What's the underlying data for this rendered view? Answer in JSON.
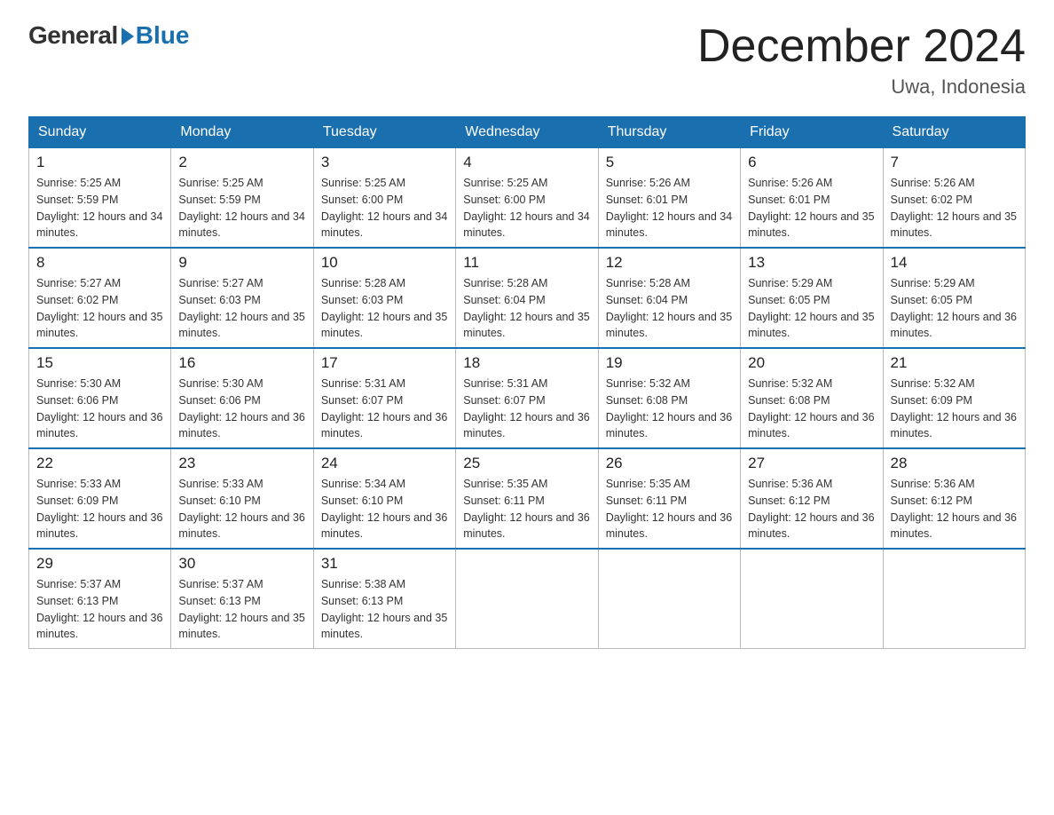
{
  "header": {
    "logo_general": "General",
    "logo_blue": "Blue",
    "title": "December 2024",
    "location": "Uwa, Indonesia"
  },
  "days_of_week": [
    "Sunday",
    "Monday",
    "Tuesday",
    "Wednesday",
    "Thursday",
    "Friday",
    "Saturday"
  ],
  "weeks": [
    [
      {
        "day": "1",
        "sunrise": "5:25 AM",
        "sunset": "5:59 PM",
        "daylight": "12 hours and 34 minutes."
      },
      {
        "day": "2",
        "sunrise": "5:25 AM",
        "sunset": "5:59 PM",
        "daylight": "12 hours and 34 minutes."
      },
      {
        "day": "3",
        "sunrise": "5:25 AM",
        "sunset": "6:00 PM",
        "daylight": "12 hours and 34 minutes."
      },
      {
        "day": "4",
        "sunrise": "5:25 AM",
        "sunset": "6:00 PM",
        "daylight": "12 hours and 34 minutes."
      },
      {
        "day": "5",
        "sunrise": "5:26 AM",
        "sunset": "6:01 PM",
        "daylight": "12 hours and 34 minutes."
      },
      {
        "day": "6",
        "sunrise": "5:26 AM",
        "sunset": "6:01 PM",
        "daylight": "12 hours and 35 minutes."
      },
      {
        "day": "7",
        "sunrise": "5:26 AM",
        "sunset": "6:02 PM",
        "daylight": "12 hours and 35 minutes."
      }
    ],
    [
      {
        "day": "8",
        "sunrise": "5:27 AM",
        "sunset": "6:02 PM",
        "daylight": "12 hours and 35 minutes."
      },
      {
        "day": "9",
        "sunrise": "5:27 AM",
        "sunset": "6:03 PM",
        "daylight": "12 hours and 35 minutes."
      },
      {
        "day": "10",
        "sunrise": "5:28 AM",
        "sunset": "6:03 PM",
        "daylight": "12 hours and 35 minutes."
      },
      {
        "day": "11",
        "sunrise": "5:28 AM",
        "sunset": "6:04 PM",
        "daylight": "12 hours and 35 minutes."
      },
      {
        "day": "12",
        "sunrise": "5:28 AM",
        "sunset": "6:04 PM",
        "daylight": "12 hours and 35 minutes."
      },
      {
        "day": "13",
        "sunrise": "5:29 AM",
        "sunset": "6:05 PM",
        "daylight": "12 hours and 35 minutes."
      },
      {
        "day": "14",
        "sunrise": "5:29 AM",
        "sunset": "6:05 PM",
        "daylight": "12 hours and 36 minutes."
      }
    ],
    [
      {
        "day": "15",
        "sunrise": "5:30 AM",
        "sunset": "6:06 PM",
        "daylight": "12 hours and 36 minutes."
      },
      {
        "day": "16",
        "sunrise": "5:30 AM",
        "sunset": "6:06 PM",
        "daylight": "12 hours and 36 minutes."
      },
      {
        "day": "17",
        "sunrise": "5:31 AM",
        "sunset": "6:07 PM",
        "daylight": "12 hours and 36 minutes."
      },
      {
        "day": "18",
        "sunrise": "5:31 AM",
        "sunset": "6:07 PM",
        "daylight": "12 hours and 36 minutes."
      },
      {
        "day": "19",
        "sunrise": "5:32 AM",
        "sunset": "6:08 PM",
        "daylight": "12 hours and 36 minutes."
      },
      {
        "day": "20",
        "sunrise": "5:32 AM",
        "sunset": "6:08 PM",
        "daylight": "12 hours and 36 minutes."
      },
      {
        "day": "21",
        "sunrise": "5:32 AM",
        "sunset": "6:09 PM",
        "daylight": "12 hours and 36 minutes."
      }
    ],
    [
      {
        "day": "22",
        "sunrise": "5:33 AM",
        "sunset": "6:09 PM",
        "daylight": "12 hours and 36 minutes."
      },
      {
        "day": "23",
        "sunrise": "5:33 AM",
        "sunset": "6:10 PM",
        "daylight": "12 hours and 36 minutes."
      },
      {
        "day": "24",
        "sunrise": "5:34 AM",
        "sunset": "6:10 PM",
        "daylight": "12 hours and 36 minutes."
      },
      {
        "day": "25",
        "sunrise": "5:35 AM",
        "sunset": "6:11 PM",
        "daylight": "12 hours and 36 minutes."
      },
      {
        "day": "26",
        "sunrise": "5:35 AM",
        "sunset": "6:11 PM",
        "daylight": "12 hours and 36 minutes."
      },
      {
        "day": "27",
        "sunrise": "5:36 AM",
        "sunset": "6:12 PM",
        "daylight": "12 hours and 36 minutes."
      },
      {
        "day": "28",
        "sunrise": "5:36 AM",
        "sunset": "6:12 PM",
        "daylight": "12 hours and 36 minutes."
      }
    ],
    [
      {
        "day": "29",
        "sunrise": "5:37 AM",
        "sunset": "6:13 PM",
        "daylight": "12 hours and 36 minutes."
      },
      {
        "day": "30",
        "sunrise": "5:37 AM",
        "sunset": "6:13 PM",
        "daylight": "12 hours and 35 minutes."
      },
      {
        "day": "31",
        "sunrise": "5:38 AM",
        "sunset": "6:13 PM",
        "daylight": "12 hours and 35 minutes."
      },
      null,
      null,
      null,
      null
    ]
  ]
}
